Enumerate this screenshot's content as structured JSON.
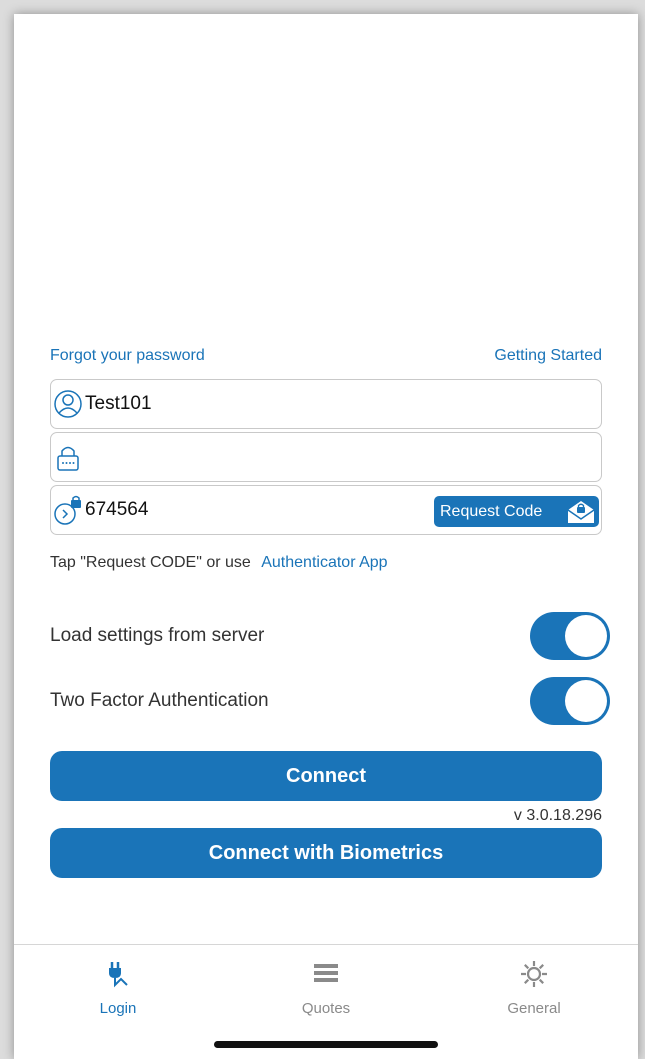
{
  "links": {
    "forgot_password": "Forgot your password",
    "getting_started": "Getting Started"
  },
  "form": {
    "username": {
      "value": "Test101",
      "icon": "user-icon"
    },
    "password": {
      "value": "",
      "icon": "lock-icon"
    },
    "code": {
      "value": "674564",
      "icon": "code-lock-icon"
    },
    "request_code_label": "Request Code",
    "request_code_icon": "envelope-lock-icon"
  },
  "help": {
    "text": "Tap \"Request CODE\" or use",
    "authenticator_link": "Authenticator App"
  },
  "toggles": [
    {
      "label": "Load settings from server",
      "on": true
    },
    {
      "label": "Two Factor Authentication",
      "on": true
    }
  ],
  "buttons": {
    "connect": "Connect",
    "biometrics": "Connect with Biometrics"
  },
  "version": "v 3.0.18.296",
  "tabs": [
    {
      "label": "Login",
      "icon": "plug-icon",
      "active": true
    },
    {
      "label": "Quotes",
      "icon": "list-icon",
      "active": false
    },
    {
      "label": "General",
      "icon": "gear-icon",
      "active": false
    }
  ],
  "colors": {
    "accent": "#1a74b8",
    "inactive": "#8a8a8a"
  }
}
